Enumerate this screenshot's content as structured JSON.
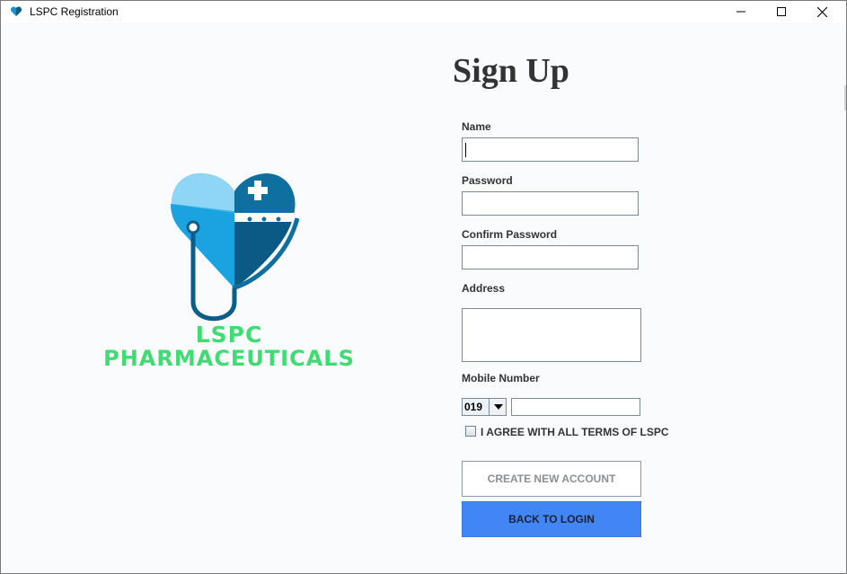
{
  "window": {
    "title": "LSPC Registration",
    "icon": "heart-logo-icon",
    "controls": [
      "minimize-icon",
      "maximize-icon",
      "close-icon"
    ]
  },
  "brand": {
    "line1": "LSPC",
    "line2": "PHARMACEUTICALS",
    "color": "#3fdc73"
  },
  "form": {
    "heading": "Sign Up",
    "name_label": "Name",
    "name_value": "",
    "password_label": "Password",
    "confirm_password_label": "Confirm Password",
    "address_label": "Address",
    "mobile_label": "Mobile Number",
    "mobile_prefix": "019",
    "mobile_value": "",
    "terms_label": "I AGREE WITH ALL TERMS OF LSPC",
    "terms_checked": false,
    "create_button": "CREATE NEW ACCOUNT",
    "back_button": "BACK TO LOGIN"
  },
  "colors": {
    "accent": "#4285f4",
    "brand_green": "#3fdc73",
    "logo_blue_light": "#4fc3f0",
    "logo_blue_dark": "#0a6e9e"
  }
}
